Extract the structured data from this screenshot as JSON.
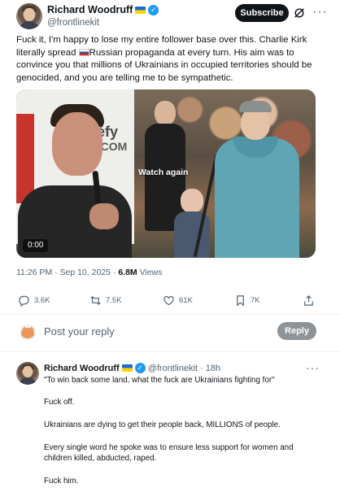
{
  "post": {
    "author_name": "Richard Woodruff",
    "author_handle": "@frontlinekit",
    "subscribe_label": "Subscribe",
    "text_part1": "Fuck it, I'm happy to lose my entire follower base over this. Charlie Kirk literally spread ",
    "text_part2": "Russian propaganda at every turn. His aim was to convince you that millions of Ukrainians in occupied territories should be genocided, and you are telling me to be sympathetic.",
    "media": {
      "overlay_label": "Watch again",
      "duration": "0:00",
      "banner_text_1": "réfy",
      "banner_text_2": "Y.COM"
    },
    "timestamp": "11:26 PM · Sep 10, 2025 · ",
    "views_count": "6.8M",
    "views_label": " Views",
    "actions": {
      "replies": "3.6K",
      "reposts": "7.5K",
      "likes": "61K",
      "bookmarks": "7K"
    }
  },
  "reply_composer": {
    "placeholder": "Post your reply",
    "button_label": "Reply"
  },
  "reply": {
    "author_name": "Richard Woodruff",
    "author_handle": "@frontlinekit",
    "time": "· 18h",
    "lines": [
      "\"To win back some land, what the fuck are Ukrainians fighting for\"",
      "Fuck off.",
      "Ukrainians are dying to get their people back, MILLIONS of people.",
      "Every single word he spoke was to ensure less support for women and children killed, abducted, raped.",
      "Fuck him."
    ]
  },
  "colors": {
    "accent": "#1d9bf0",
    "text": "#0f1419",
    "muted": "#536471",
    "reply_button": "#8e9398"
  },
  "icons": [
    "verified-icon",
    "ukraine-flag-icon",
    "grok-icon",
    "more-icon",
    "russia-flag-icon",
    "reply-icon",
    "repost-icon",
    "like-icon",
    "bookmark-icon",
    "share-icon"
  ]
}
